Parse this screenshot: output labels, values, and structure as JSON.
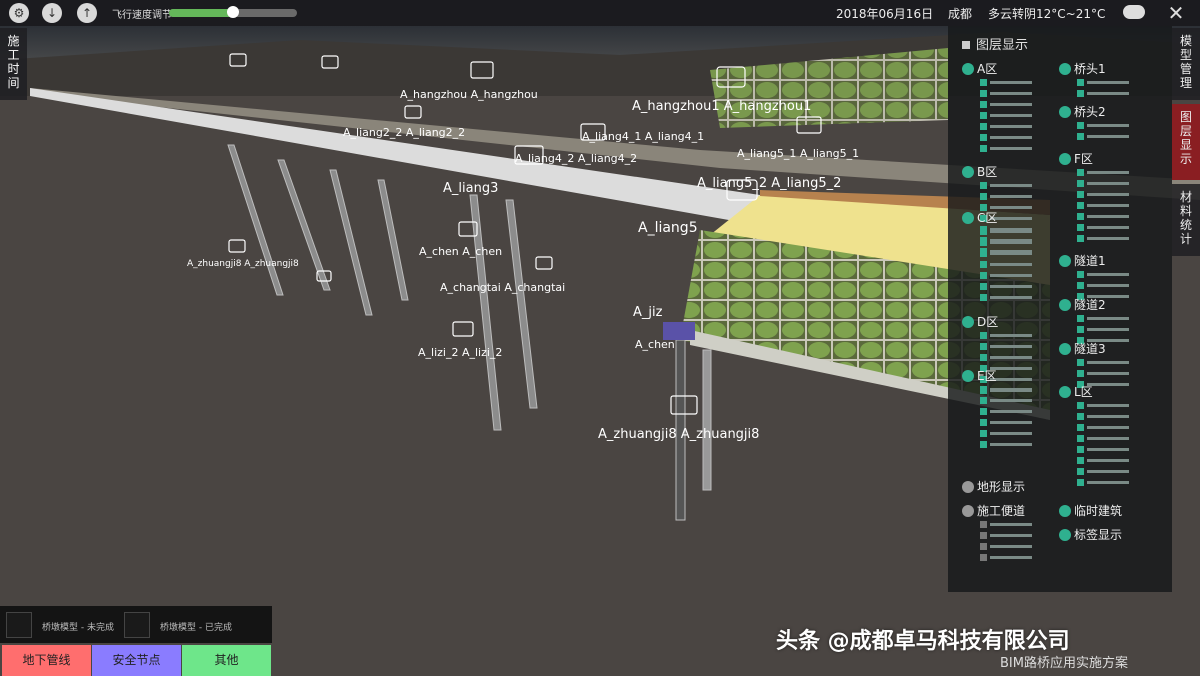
{
  "topbar": {
    "speed_label": "飞行速度调节",
    "speed_level": 0.5,
    "date": "2018年06月16日",
    "city": "成都",
    "weather": "多云转阴12°C~21°C",
    "icons": [
      "settings-icon",
      "download-icon",
      "upload-icon",
      "weather-cloud-icon",
      "close-icon"
    ]
  },
  "left_tab": {
    "label": "施工时间"
  },
  "right_tabs": [
    {
      "label": "模型管理",
      "active": false
    },
    {
      "label": "图层显示",
      "active": true
    },
    {
      "label": "材料统计",
      "active": false
    }
  ],
  "layer_panel": {
    "title": "图层显示",
    "groups": [
      {
        "label": "A区",
        "items": 7
      },
      {
        "label": "B区",
        "items": 7
      },
      {
        "label": "C区",
        "items": 7
      },
      {
        "label": "D区",
        "items": 6
      },
      {
        "label": "E区",
        "items": 6
      },
      {
        "label": "地形显示",
        "items": 0
      },
      {
        "label": "施工便道",
        "items": 4
      },
      {
        "label": "桥头1",
        "items": 2
      },
      {
        "label": "桥头2",
        "items": 2
      },
      {
        "label": "F区",
        "items": 7
      },
      {
        "label": "隧道1",
        "items": 3
      },
      {
        "label": "隧道2",
        "items": 3
      },
      {
        "label": "隧道3",
        "items": 3
      },
      {
        "label": "L区",
        "items": 8
      },
      {
        "label": "临时建筑",
        "items": 0
      },
      {
        "label": "标签显示",
        "items": 0
      }
    ]
  },
  "scene_labels": [
    "A_hangzhou1 A_hangzhou1",
    "A_hangzhou A_hangzhou",
    "A_liang4_1 A_liang4_1",
    "A_liang4_2 A_liang4_2",
    "A_liang5_1 A_liang5_1",
    "A_liang5_2 A_liang5_2",
    "A_liang5",
    "A_liang2_2 A_liang2_2",
    "A_liang3",
    "A_zhuangji8 A_zhuangji8",
    "A_jiz",
    "A_chen",
    "A_lizi_2 A_lizi_2",
    "A_changtai A_changtai",
    "A_chen A_chen",
    "A_zhuangji8 A_zhuangji8"
  ],
  "bottom_left": {
    "text1": "桥墩模型 - 未完成",
    "text2": "桥墩模型 - 已完成"
  },
  "bottom_buttons": [
    {
      "label": "地下管线",
      "color": "#ff6e6e"
    },
    {
      "label": "安全节点",
      "color": "#8a7cff"
    },
    {
      "label": "其他",
      "color": "#6ee68a"
    }
  ],
  "watermark": {
    "main": "头条 @成都卓马科技有限公司",
    "sub": "BIM路桥应用实施方案"
  }
}
